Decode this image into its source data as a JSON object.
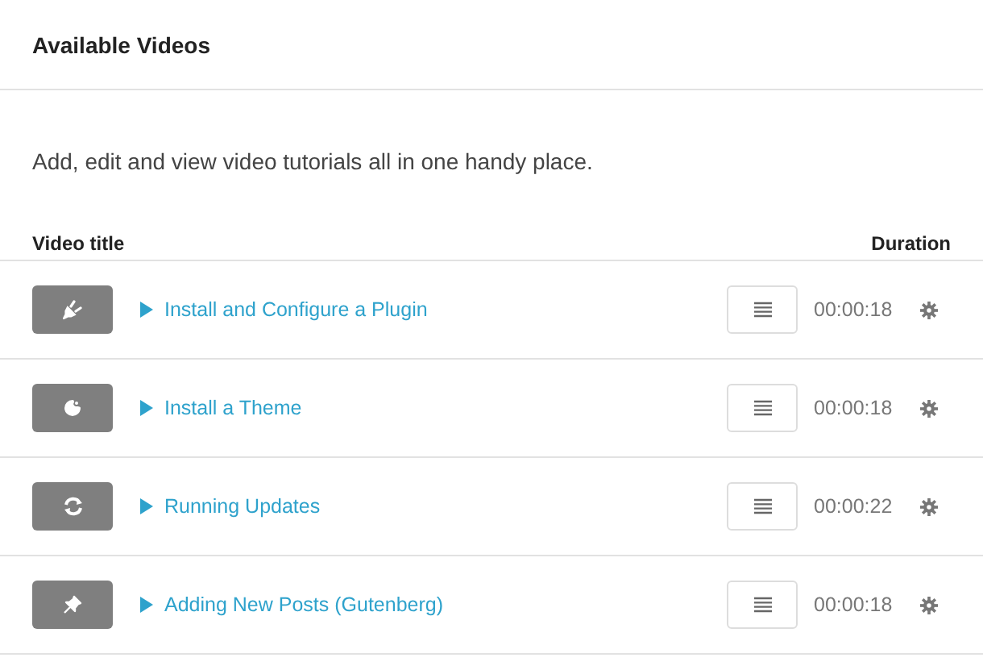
{
  "header": {
    "title": "Available Videos"
  },
  "description": "Add, edit and view video tutorials all in one handy place.",
  "table": {
    "columns": [
      "Video title",
      "Duration"
    ],
    "rows": [
      {
        "kind": "plug",
        "title": "Install and Configure a Plugin",
        "duration": "00:00:18"
      },
      {
        "kind": "palette",
        "title": "Install a Theme",
        "duration": "00:00:18"
      },
      {
        "kind": "refresh",
        "title": "Running Updates",
        "duration": "00:00:22"
      },
      {
        "kind": "pin",
        "title": "Adding New Posts (Gutenberg)",
        "duration": "00:00:18"
      }
    ]
  }
}
